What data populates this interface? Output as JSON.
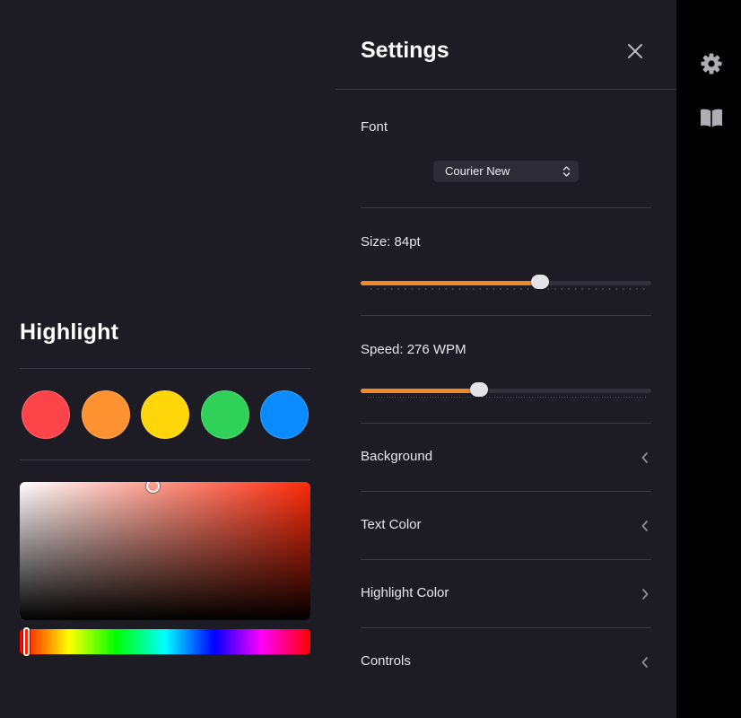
{
  "highlight": {
    "title": "Highlight",
    "swatches": [
      {
        "name": "red",
        "color": "#fd4449"
      },
      {
        "name": "orange",
        "color": "#fe9230"
      },
      {
        "name": "yellow",
        "color": "#ffd60a"
      },
      {
        "name": "green",
        "color": "#30d158"
      },
      {
        "name": "blue",
        "color": "#0a8bff"
      }
    ],
    "picker": {
      "hue_color": "#ff2a0a",
      "selected_hue_fraction": 0.01
    }
  },
  "settings": {
    "title": "Settings",
    "font": {
      "label": "Font",
      "selected": "Courier New"
    },
    "size": {
      "label": "Size: 84pt",
      "fraction": 0.617
    },
    "speed": {
      "label": "Speed: 276 WPM",
      "fraction": 0.407
    },
    "sections": [
      {
        "label": "Background",
        "chevron": "chevron-left"
      },
      {
        "label": "Text Color",
        "chevron": "chevron-left"
      },
      {
        "label": "Highlight Color",
        "chevron": "chevron-right"
      },
      {
        "label": "Controls",
        "chevron": "chevron-left"
      }
    ]
  },
  "sidebar": {
    "icons": [
      "gear-icon",
      "book-icon"
    ]
  },
  "colors": {
    "accent": "#f0892a",
    "panel_bg": "#1d1c24",
    "sidebar_bg": "#000000"
  }
}
